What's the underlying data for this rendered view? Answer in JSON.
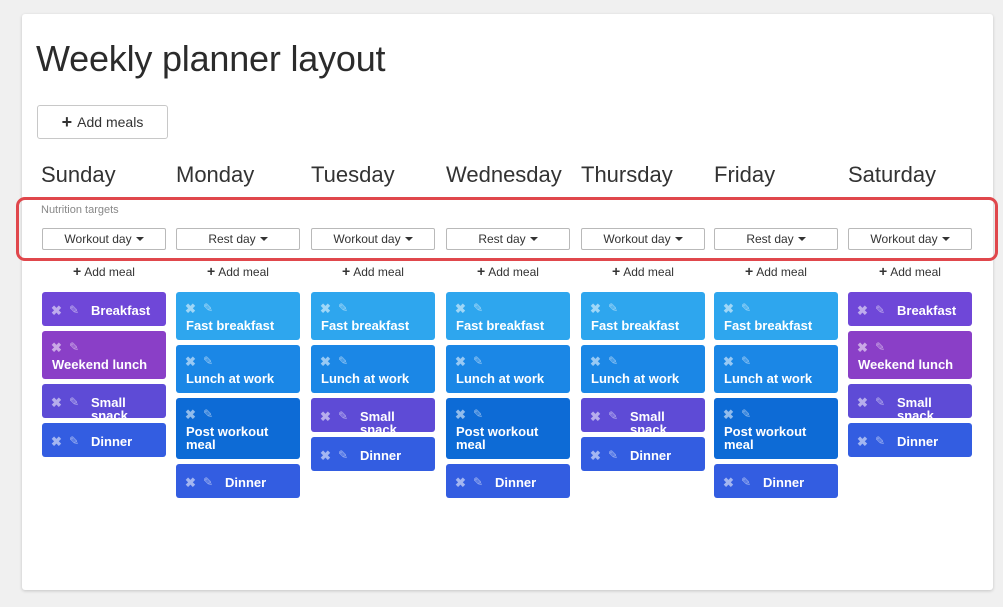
{
  "title": "Weekly planner layout",
  "add_meals_label": "Add meals",
  "nutrition_targets_label": "Nutrition targets",
  "add_meal_label": "Add meal",
  "colors": {
    "highlight": "#e0474c",
    "light_blue": "#2ea6ee",
    "mid_blue": "#1b87e6",
    "deep_blue": "#0d6bd6",
    "indigo": "#335de1",
    "violet": "#5e4bd6",
    "purple": "#8a3fc7",
    "plum": "#6f47d8"
  },
  "days": [
    {
      "name": "Sunday",
      "target": "Workout day",
      "meals": [
        {
          "label": "Breakfast",
          "color": "#6f47d8"
        },
        {
          "label": "Weekend lunch",
          "color": "#8a3fc7"
        },
        {
          "label": "Small snack",
          "color": "#5e4bd6"
        },
        {
          "label": "Dinner",
          "color": "#335de1"
        }
      ]
    },
    {
      "name": "Monday",
      "target": "Rest day",
      "meals": [
        {
          "label": "Fast breakfast",
          "color": "#2ea6ee"
        },
        {
          "label": "Lunch at work",
          "color": "#1b87e6"
        },
        {
          "label": "Post workout meal",
          "color": "#0d6bd6"
        },
        {
          "label": "Dinner",
          "color": "#335de1"
        }
      ]
    },
    {
      "name": "Tuesday",
      "target": "Workout day",
      "meals": [
        {
          "label": "Fast breakfast",
          "color": "#2ea6ee"
        },
        {
          "label": "Lunch at work",
          "color": "#1b87e6"
        },
        {
          "label": "Small snack",
          "color": "#5e4bd6"
        },
        {
          "label": "Dinner",
          "color": "#335de1"
        }
      ]
    },
    {
      "name": "Wednesday",
      "target": "Rest day",
      "meals": [
        {
          "label": "Fast breakfast",
          "color": "#2ea6ee"
        },
        {
          "label": "Lunch at work",
          "color": "#1b87e6"
        },
        {
          "label": "Post workout meal",
          "color": "#0d6bd6"
        },
        {
          "label": "Dinner",
          "color": "#335de1"
        }
      ]
    },
    {
      "name": "Thursday",
      "target": "Workout day",
      "meals": [
        {
          "label": "Fast breakfast",
          "color": "#2ea6ee"
        },
        {
          "label": "Lunch at work",
          "color": "#1b87e6"
        },
        {
          "label": "Small snack",
          "color": "#5e4bd6"
        },
        {
          "label": "Dinner",
          "color": "#335de1"
        }
      ]
    },
    {
      "name": "Friday",
      "target": "Rest day",
      "meals": [
        {
          "label": "Fast breakfast",
          "color": "#2ea6ee"
        },
        {
          "label": "Lunch at work",
          "color": "#1b87e6"
        },
        {
          "label": "Post workout meal",
          "color": "#0d6bd6"
        },
        {
          "label": "Dinner",
          "color": "#335de1"
        }
      ]
    },
    {
      "name": "Saturday",
      "target": "Workout day",
      "meals": [
        {
          "label": "Breakfast",
          "color": "#6f47d8"
        },
        {
          "label": "Weekend lunch",
          "color": "#8a3fc7"
        },
        {
          "label": "Small snack",
          "color": "#5e4bd6"
        },
        {
          "label": "Dinner",
          "color": "#335de1"
        }
      ]
    }
  ]
}
